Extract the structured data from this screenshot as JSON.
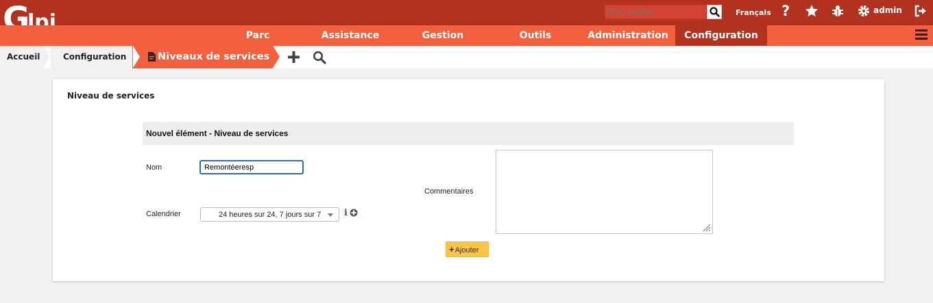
{
  "header": {
    "logo_text": "Glpi",
    "search_placeholder": "Rechercher",
    "language": "Français",
    "user": "admin"
  },
  "menu": {
    "items": [
      {
        "label": "Parc"
      },
      {
        "label": "Assistance"
      },
      {
        "label": "Gestion"
      },
      {
        "label": "Outils"
      },
      {
        "label": "Administration"
      },
      {
        "label": "Configuration",
        "active": true
      }
    ]
  },
  "breadcrumb": {
    "items": [
      "Accueil",
      "Configuration",
      "Niveaux de services"
    ]
  },
  "panel": {
    "title": "Niveau de services",
    "form_header": "Nouvel élément - Niveau de services",
    "nom_label": "Nom",
    "nom_value": "Remontéeresp",
    "calendrier_label": "Calendrier",
    "calendrier_value": "24 heures sur 24, 7 jours sur 7",
    "commentaires_label": "Commentaires",
    "commentaires_value": "",
    "submit_label": "Ajouter"
  },
  "colors": {
    "header_dark": "#b3311f",
    "menu": "#f2603d",
    "submit": "#fdc448",
    "input_focus": "#2a6bb3"
  },
  "icons": [
    "search-icon",
    "help-icon",
    "star-icon",
    "bug-icon",
    "gear-icon",
    "logout-icon",
    "hamburger-icon",
    "document-icon",
    "add-icon",
    "search-icon",
    "info-icon",
    "add-circle-icon",
    "plus-icon"
  ]
}
